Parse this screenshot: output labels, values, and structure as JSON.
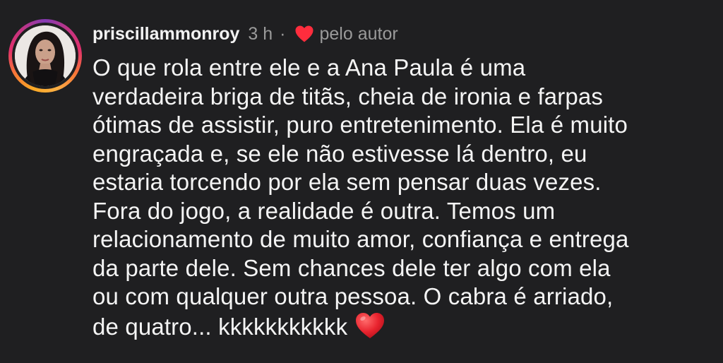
{
  "comment": {
    "username": "priscillammonroy",
    "time_ago": "3 h",
    "separator": "·",
    "liked_by_author_label": "pelo autor",
    "text_lines": [
      "O que rola entre ele e a Ana Paula é uma",
      "verdadeira briga de titãs, cheia de ironia e farpas",
      "ótimas de assistir, puro entretenimento. Ela é muito",
      "engraçada e, se ele não estivesse lá dentro, eu",
      "estaria torcendo por ela sem pensar duas vezes.",
      "Fora do jogo, a realidade é outra. Temos um",
      "relacionamento de muito amor, confiança e entrega",
      "da parte dele. Sem chances dele ter algo com ela",
      "ou com qualquer outra pessoa. O cabra é arriado,",
      "de quatro... kkkkkkkkkkk"
    ],
    "icons": {
      "liked_heart": "heart-icon",
      "emoji": "red-heart-emoji"
    },
    "colors": {
      "background": "#1f1f21",
      "heart": "#ff2d3d",
      "meta_text": "#9a9a9a"
    }
  }
}
